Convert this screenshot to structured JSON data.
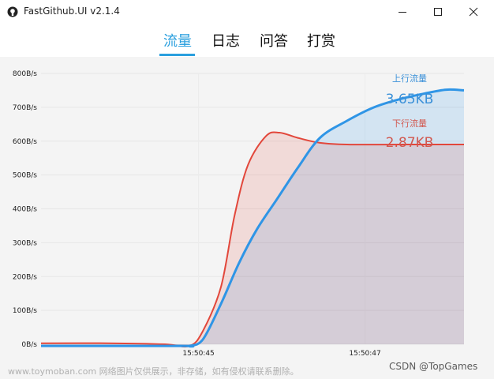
{
  "window": {
    "title": "FastGithub.UI v2.1.4",
    "minimize_icon": "minimize-icon",
    "maximize_icon": "maximize-icon",
    "close_icon": "close-icon"
  },
  "tabs": [
    {
      "label": "流量",
      "active": true
    },
    {
      "label": "日志",
      "active": false
    },
    {
      "label": "问答",
      "active": false
    },
    {
      "label": "打赏",
      "active": false
    }
  ],
  "stats": {
    "upload_label": "上行流量",
    "upload_value": "3.65KB",
    "download_label": "下行流量",
    "download_value": "2.87KB"
  },
  "colors": {
    "accent": "#2a9fde",
    "upload_line": "#2f95e6",
    "download_line": "#e2473b",
    "upload_text": "#3a90d8",
    "download_text": "#d2574e"
  },
  "chart_data": {
    "type": "area",
    "title": "",
    "xlabel": "",
    "ylabel": "",
    "ylim": [
      0,
      800
    ],
    "y_ticks": [
      "0B/s",
      "100B/s",
      "200B/s",
      "300B/s",
      "400B/s",
      "500B/s",
      "600B/s",
      "700B/s",
      "800B/s"
    ],
    "x_ticks": [
      "15:50:45",
      "15:50:47"
    ],
    "grid": true,
    "series": [
      {
        "name": "上行流量",
        "points": [
          [
            0.0,
            -5
          ],
          [
            0.62,
            -5
          ],
          [
            0.66,
            -5
          ],
          [
            0.72,
            15
          ],
          [
            0.8,
            120
          ],
          [
            0.88,
            240
          ],
          [
            0.96,
            340
          ],
          [
            1.05,
            430
          ],
          [
            1.14,
            520
          ],
          [
            1.24,
            610
          ],
          [
            1.36,
            660
          ],
          [
            1.48,
            700
          ],
          [
            1.6,
            725
          ],
          [
            1.7,
            740
          ],
          [
            1.8,
            752
          ],
          [
            1.88,
            750
          ]
        ]
      },
      {
        "name": "下行流量",
        "points": [
          [
            0.0,
            3
          ],
          [
            0.3,
            3
          ],
          [
            0.55,
            0
          ],
          [
            0.66,
            -5
          ],
          [
            0.72,
            40
          ],
          [
            0.8,
            170
          ],
          [
            0.86,
            380
          ],
          [
            0.92,
            530
          ],
          [
            1.0,
            615
          ],
          [
            1.06,
            625
          ],
          [
            1.14,
            610
          ],
          [
            1.24,
            595
          ],
          [
            1.36,
            590
          ],
          [
            1.6,
            590
          ],
          [
            1.88,
            590
          ]
        ]
      }
    ]
  },
  "overlay": {
    "watermark": "www.toymoban.com 网络图片仅供展示，非存储，如有侵权请联系删除。",
    "csdn": "CSDN @TopGames"
  }
}
